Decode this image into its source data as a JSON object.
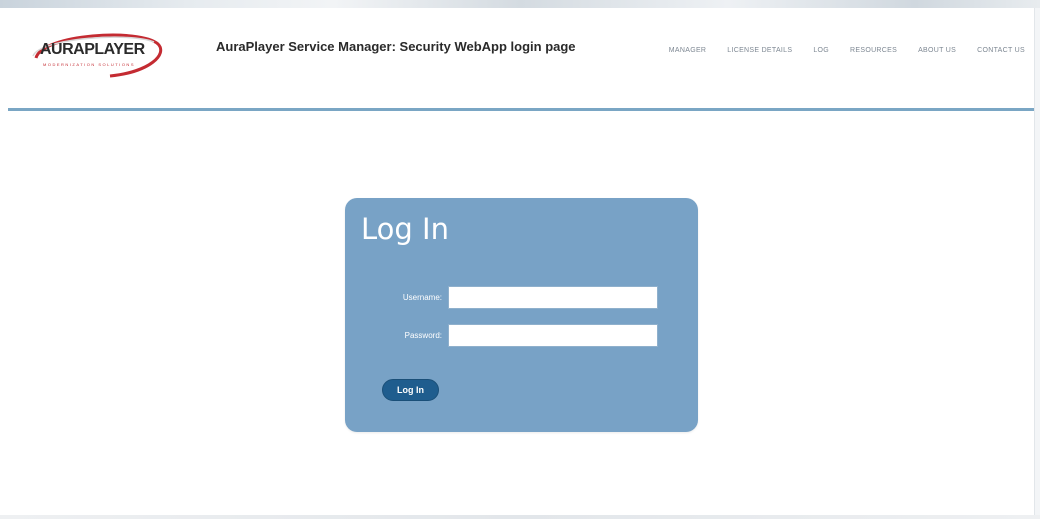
{
  "header": {
    "logo_text": "AURAPLAYER",
    "logo_tagline": "MODERNIZATION SOLUTIONS",
    "page_title": "AuraPlayer Service Manager: Security WebApp login page",
    "nav": [
      {
        "label": "MANAGER"
      },
      {
        "label": "LICENSE DETAILS"
      },
      {
        "label": "LOG"
      },
      {
        "label": "RESOURCES"
      },
      {
        "label": "ABOUT US"
      },
      {
        "label": "CONTACT US"
      }
    ]
  },
  "login": {
    "title": "Log In",
    "username_label": "Username:",
    "username_value": "",
    "password_label": "Password:",
    "password_value": "",
    "submit_label": "Log In"
  },
  "colors": {
    "accent": "#78a2c6",
    "button": "#1f5d8e",
    "logo_red": "#c42b32",
    "header_rule": "#7aa6c4"
  }
}
